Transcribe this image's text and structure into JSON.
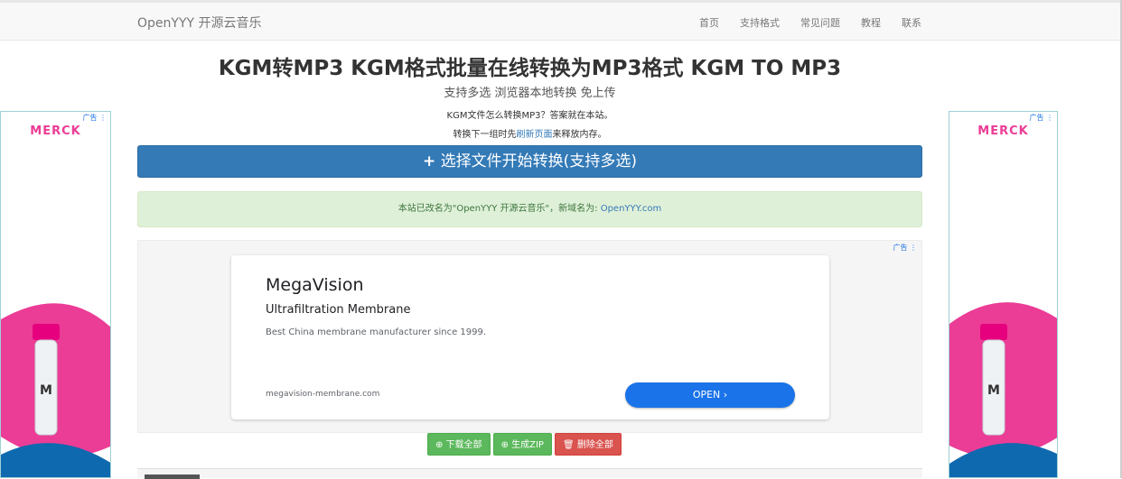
{
  "nav": {
    "brand": "OpenYYY 开源云音乐",
    "links": [
      "首页",
      "支持格式",
      "常见问题",
      "教程",
      "联系"
    ]
  },
  "main": {
    "title": "KGM转MP3 KGM格式批量在线转换为MP3格式 KGM TO MP3",
    "subtitle": "支持多选 浏览器本地转换 免上传",
    "line1": "KGM文件怎么转换MP3？答案就在本站。",
    "line2_before": "转换下一组时先",
    "line2_link": "刷新页面",
    "line2_after": "来释放内存。",
    "select_icon": "+",
    "select_button": "选择文件开始转换(支持多选)",
    "notice_text": "本站已改名为\"OpenYYY 开源云音乐\"，新域名为: ",
    "notice_domain": "OpenYYY.com"
  },
  "ad": {
    "tag": "广告 ⋮",
    "headline": "MegaVision",
    "subhead": "Ultrafiltration Membrane",
    "description": "Best China membrane manufacturer since 1999.",
    "url": "megavision-membrane.com",
    "open_label": "OPEN ›"
  },
  "side_ads": {
    "tag": "广告 ⋮",
    "brand": "MERCK",
    "brand_color": "#eb3c96"
  },
  "actions": {
    "download_all": "⊕ 下载全部",
    "zip": "⊕ 生成ZIP",
    "delete_all": "🗑 删除全部"
  },
  "colors": {
    "primary": "#337ab7",
    "success": "#5cb85c",
    "danger": "#d9534f",
    "ad_blue": "#1a73e8"
  }
}
